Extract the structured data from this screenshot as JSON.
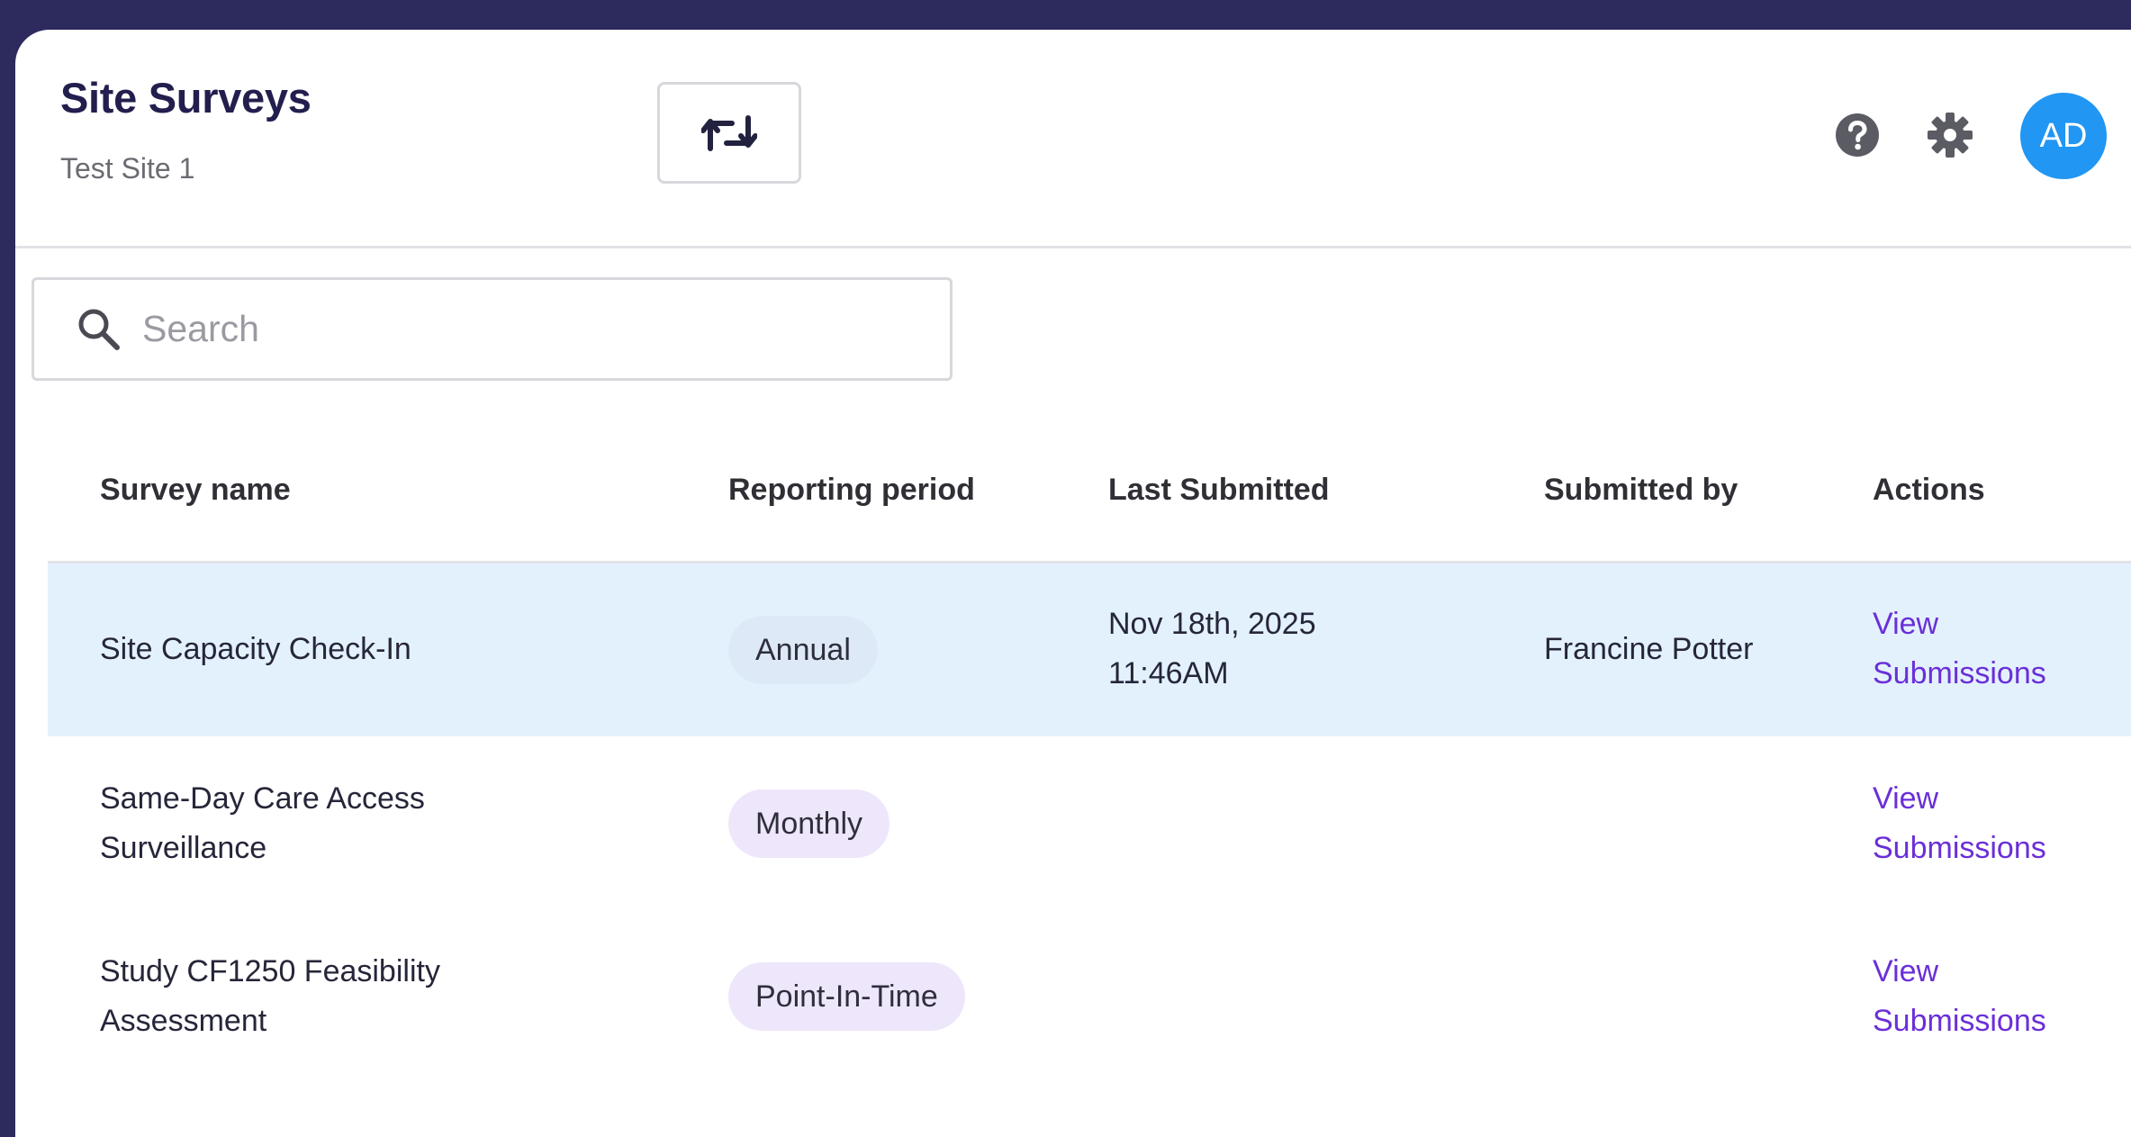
{
  "header": {
    "title": "Site Surveys",
    "subtitle": "Test Site 1",
    "switch_icon": "swap-arrows-icon",
    "help_icon": "question-circle-icon",
    "settings_icon": "gear-icon",
    "avatar_initials": "AD"
  },
  "search": {
    "placeholder": "Search",
    "value": ""
  },
  "table": {
    "columns": [
      "Survey name",
      "Reporting period",
      "Last Submitted",
      "Submitted by",
      "Actions"
    ],
    "rows": [
      {
        "name_line1": "Site Capacity Check-In",
        "name_line2": "",
        "period": "Annual",
        "last_submitted_line1": "Nov 18th, 2025",
        "last_submitted_line2": "11:46AM",
        "submitted_by": "Francine Potter",
        "action_line1": "View",
        "action_line2": "Submissions",
        "highlighted": true
      },
      {
        "name_line1": "Same-Day Care Access",
        "name_line2": "Surveillance",
        "period": "Monthly",
        "last_submitted_line1": "",
        "last_submitted_line2": "",
        "submitted_by": "",
        "action_line1": "View",
        "action_line2": "Submissions",
        "highlighted": false
      },
      {
        "name_line1": "Study CF1250 Feasibility",
        "name_line2": "Assessment",
        "period": "Point-In-Time",
        "last_submitted_line1": "",
        "last_submitted_line2": "",
        "submitted_by": "",
        "action_line1": "View",
        "action_line2": "Submissions",
        "highlighted": false
      }
    ]
  },
  "colors": {
    "frame": "#2d2a5e",
    "title": "#221f4e",
    "avatar": "#2196f3",
    "highlight_row": "#e3f1fd",
    "pill": "#eee6fb",
    "link": "#6a2fd8"
  }
}
